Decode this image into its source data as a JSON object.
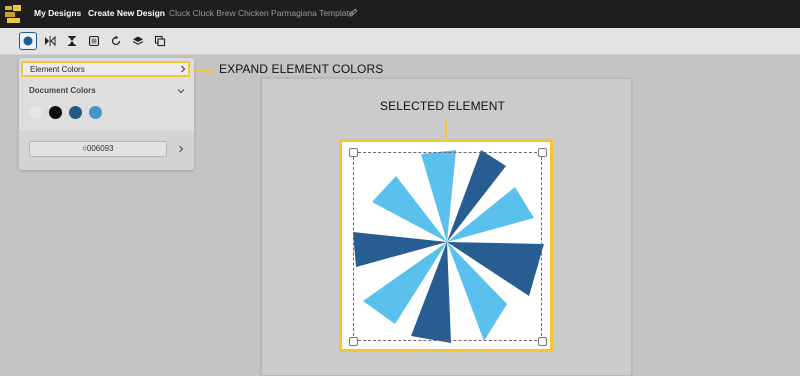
{
  "topbar": {
    "my_designs": "My Designs",
    "create_new": "Create New Design",
    "document_title": "Cluck Cluck Brew Chicken Parmagiana Template"
  },
  "colors_panel": {
    "element_colors_label": "Element Colors",
    "document_colors_label": "Document Colors",
    "hex_value": "006093",
    "swatches": [
      "#e6e6e6",
      "#0b0b0b",
      "#245989",
      "#4695c6"
    ]
  },
  "annotations": {
    "expand": "EXPAND ELEMENT COLORS",
    "selected": "SELECTED ELEMENT"
  },
  "colors": {
    "accent": "#f5c532",
    "dark_blue": "#275d91",
    "light_blue": "#5ac0ee"
  }
}
